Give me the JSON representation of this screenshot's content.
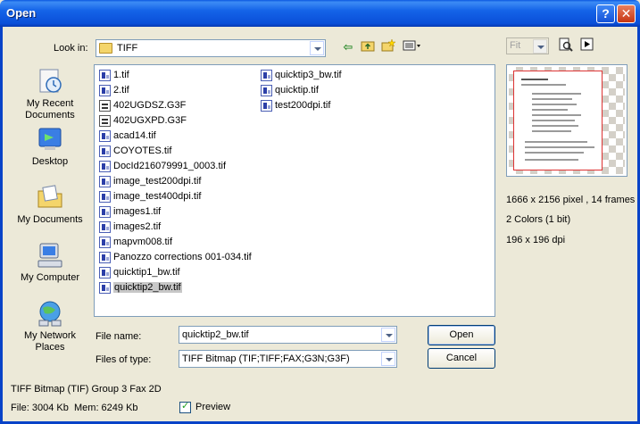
{
  "window": {
    "title": "Open",
    "help_label": "?",
    "close_label": "✕"
  },
  "toolbar": {
    "look_in_label": "Look in:",
    "look_in_value": "TIFF",
    "icons": [
      "back-arrow-icon",
      "up-folder-icon",
      "new-folder-icon",
      "views-menu-icon"
    ],
    "zoom_value": "Fit"
  },
  "places": [
    {
      "id": "recent",
      "label": "My Recent Documents",
      "icon": "recent-documents-icon"
    },
    {
      "id": "desktop",
      "label": "Desktop",
      "icon": "desktop-icon"
    },
    {
      "id": "mydocs",
      "label": "My Documents",
      "icon": "my-documents-icon"
    },
    {
      "id": "computer",
      "label": "My Computer",
      "icon": "my-computer-icon"
    },
    {
      "id": "network",
      "label": "My Network Places",
      "icon": "network-places-icon"
    }
  ],
  "files": {
    "col1": [
      "1.tif",
      "2.tif",
      "402UGDSZ.G3F",
      "402UGXPD.G3F",
      "acad14.tif",
      "COYOTES.tif",
      "DocId216079991_0003.tif",
      "image_test200dpi.tif",
      "image_test400dpi.tif",
      "images1.tif",
      "images2.tif",
      "mapvm008.tif",
      "Panozzo corrections 001-034.tif",
      "quicktip1_bw.tif",
      "quicktip2_bw.tif"
    ],
    "col2": [
      "quicktip3_bw.tif",
      "quicktip.tif",
      "test200dpi.tif"
    ],
    "selected": "quicktip2_bw.tif"
  },
  "form": {
    "file_name_label": "File name:",
    "file_name_value": "quicktip2_bw.tif",
    "file_type_label": "Files of type:",
    "file_type_value": "TIFF Bitmap (TIF;TIFF;FAX;G3N;G3F)",
    "open_label": "Open",
    "cancel_label": "Cancel"
  },
  "info": {
    "dimensions": "1666 x 2156 pixel , 14 frames",
    "colors": "2 Colors (1 bit)",
    "dpi": "196 x 196 dpi",
    "format": "TIFF Bitmap (TIF) Group 3 Fax 2D",
    "file_size": "File: 3004 Kb",
    "mem_size": "Mem: 6249 Kb",
    "preview_label": "Preview",
    "preview_checked": true
  }
}
